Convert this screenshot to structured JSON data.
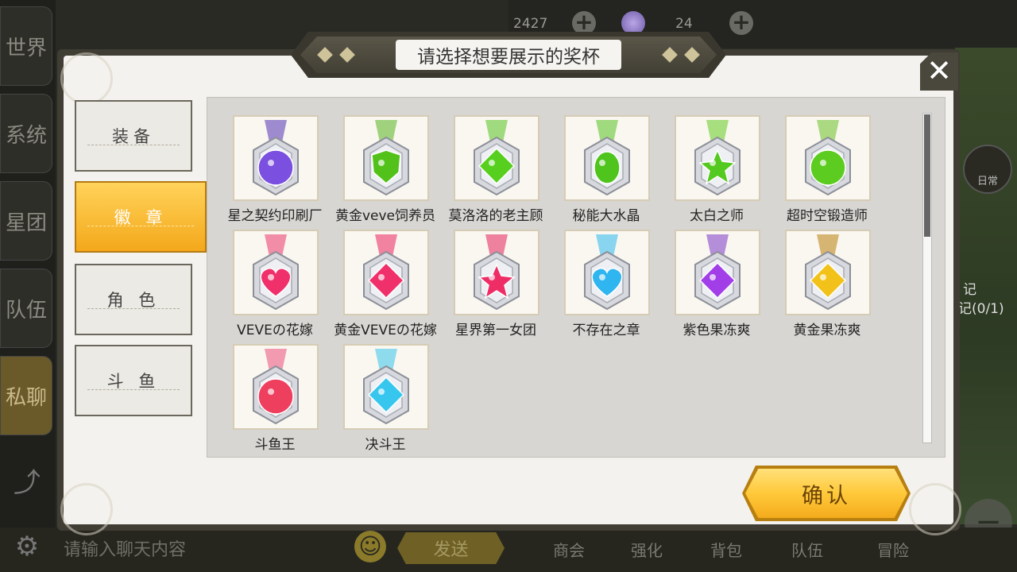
{
  "background": {
    "sidebar_tabs": [
      "世界",
      "系统",
      "星团",
      "队伍",
      "私聊"
    ],
    "top_bar": {
      "currency_1": "2427",
      "currency_2": "24"
    },
    "chat_placeholder": "请输入聊天内容",
    "send_label": "发送",
    "bottom_nav": [
      "商会",
      "强化",
      "背包",
      "队伍",
      "冒险"
    ],
    "right_panel": {
      "button_label": "日常",
      "note_text": "记",
      "note_progress": "记(0/1)"
    }
  },
  "dialog": {
    "title": "请选择想要展示的奖杯",
    "close_symbol": "✕",
    "confirm_label": "确认",
    "categories": [
      {
        "label": "装备",
        "active": false
      },
      {
        "label": "徽 章",
        "active": true
      },
      {
        "label": "角 色",
        "active": false
      },
      {
        "label": "斗 鱼",
        "active": false
      }
    ],
    "medals": [
      {
        "name": "星之契约印刷厂",
        "gem": "#7b4fe0",
        "ribbon": "#8d78c9",
        "shape": "round"
      },
      {
        "name": "黄金veve饲养员",
        "gem": "#52c21a",
        "ribbon": "#8fcb6a",
        "shape": "shield"
      },
      {
        "name": "莫洛洛的老主顾",
        "gem": "#56cf1e",
        "ribbon": "#8fd56a",
        "shape": "diamond"
      },
      {
        "name": "秘能大水晶",
        "gem": "#4ec41c",
        "ribbon": "#8fd56a",
        "shape": "drop"
      },
      {
        "name": "太白之师",
        "gem": "#54c91f",
        "ribbon": "#98d96a",
        "shape": "star"
      },
      {
        "name": "超时空锻造师",
        "gem": "#5ccc20",
        "ribbon": "#9bd46d",
        "shape": "round"
      },
      {
        "name": "VEVEの花嫁",
        "gem": "#f0306a",
        "ribbon": "#f07a9a",
        "shape": "heart"
      },
      {
        "name": "黄金VEVEの花嫁",
        "gem": "#f0306a",
        "ribbon": "#ee6d92",
        "shape": "diamond"
      },
      {
        "name": "星界第一女团",
        "gem": "#ee2d66",
        "ribbon": "#ea6c8f",
        "shape": "star"
      },
      {
        "name": "不存在之章",
        "gem": "#2fb5f0",
        "ribbon": "#74cfee",
        "shape": "heart"
      },
      {
        "name": "紫色果冻爽",
        "gem": "#a23ee8",
        "ribbon": "#a77bd4",
        "shape": "diamond"
      },
      {
        "name": "黄金果冻爽",
        "gem": "#f2c21a",
        "ribbon": "#cfa85a",
        "shape": "diamond"
      },
      {
        "name": "斗鱼王",
        "gem": "#ef3f5e",
        "ribbon": "#f08aa3",
        "shape": "round"
      },
      {
        "name": "决斗王",
        "gem": "#37c7ee",
        "ribbon": "#7ad6ec",
        "shape": "diamond"
      }
    ]
  }
}
